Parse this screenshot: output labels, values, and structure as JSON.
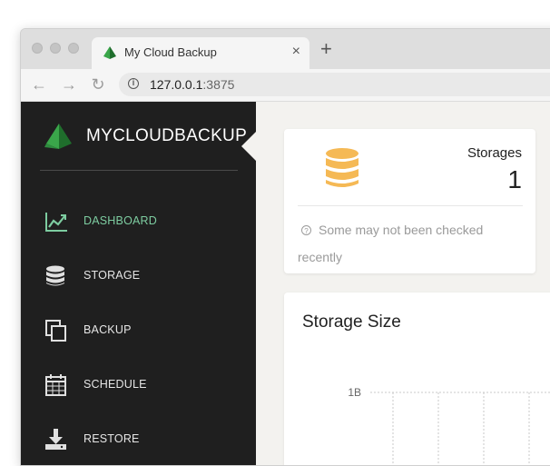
{
  "browser": {
    "tab_title": "My Cloud Backup",
    "tab_close": "×",
    "new_tab": "+",
    "url_host": "127.0.0.1",
    "url_port": ":3875",
    "back": "←",
    "forward": "→",
    "reload": "↻"
  },
  "sidebar": {
    "brand": "MYCLOUDBACKUP",
    "items": [
      {
        "label": "DASHBOARD",
        "icon": "chart-line-icon",
        "active": true
      },
      {
        "label": "STORAGE",
        "icon": "database-icon",
        "active": false
      },
      {
        "label": "BACKUP",
        "icon": "copy-icon",
        "active": false
      },
      {
        "label": "SCHEDULE",
        "icon": "calendar-icon",
        "active": false
      },
      {
        "label": "RESTORE",
        "icon": "download-icon",
        "active": false
      }
    ]
  },
  "storages_card": {
    "label": "Storages",
    "value": "1",
    "footnote": "Some may not been checked recently",
    "icon": "database-icon",
    "icon_color": "#f5b955"
  },
  "chart_data": {
    "type": "bar",
    "title": "Storage Size",
    "y_tick_labels": [
      "1B"
    ],
    "grid": true
  },
  "colors": {
    "sidebar_bg": "#1f1f1f",
    "active": "#7dcca0",
    "accent_orange": "#f5b955",
    "brand_green": "#2e8b3e"
  }
}
